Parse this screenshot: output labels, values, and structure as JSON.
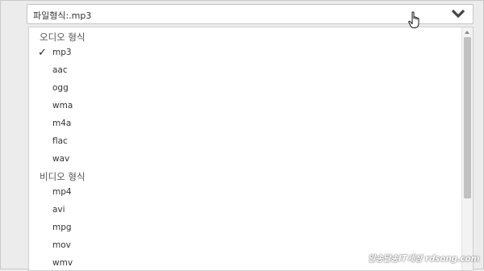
{
  "select": {
    "label": "파일형식:",
    "value": ".mp3",
    "icon": "chevron-down-icon"
  },
  "dropdown": {
    "groups": [
      {
        "label": "오디오 형식",
        "items": [
          {
            "label": "mp3",
            "selected": true
          },
          {
            "label": "aac"
          },
          {
            "label": "ogg"
          },
          {
            "label": "wma"
          },
          {
            "label": "m4a"
          },
          {
            "label": "flac"
          },
          {
            "label": "wav"
          }
        ]
      },
      {
        "label": "비디오 형식",
        "items": [
          {
            "label": "mp4"
          },
          {
            "label": "avi"
          },
          {
            "label": "mpg"
          },
          {
            "label": "mov"
          },
          {
            "label": "wmv"
          }
        ]
      }
    ],
    "check_glyph": "✓"
  },
  "watermark": "알송달송IT세상 rdsong.com",
  "colors": {
    "background": "#ececec",
    "scroll_thumb": "#c1c1c1",
    "text": "#333333"
  }
}
